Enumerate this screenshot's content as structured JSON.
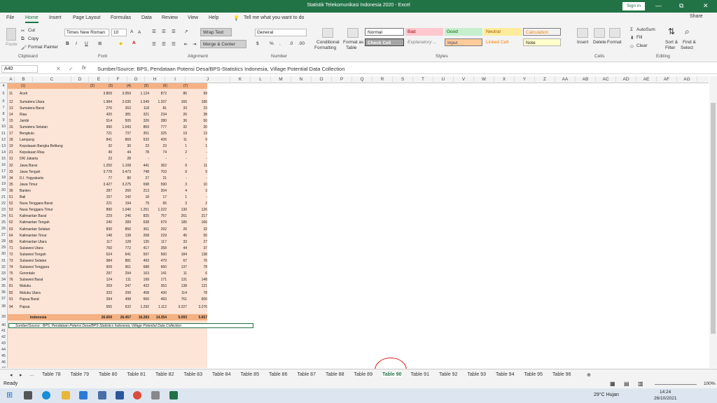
{
  "title_bar": {
    "title": "Statistik Telekomunikasi Indonesia 2020  -  Excel",
    "signin": "Sign in",
    "min": "—",
    "max": "⧉",
    "close": "✕"
  },
  "menu": {
    "tabs": [
      "File",
      "Home",
      "Insert",
      "Page Layout",
      "Formulas",
      "Data",
      "Review",
      "View",
      "Help"
    ],
    "active": "Home",
    "tell": "Tell me what you want to do",
    "share": "Share"
  },
  "ribbon": {
    "cut": "Cut",
    "copy": "Copy",
    "format_painter": "Format Painter",
    "paste": "Paste",
    "font": "Times New Roman",
    "size": "10",
    "wrap": "Wrap Text",
    "merge": "Merge & Center",
    "number_format": "General",
    "conditional": "Conditional",
    "formatting": "Formatting",
    "format_as": "Format as",
    "table": "Table",
    "styles": [
      "Normal",
      "Bad",
      "Good",
      "Neutral",
      "Calculation",
      "Check Cell",
      "Explanatory ...",
      "Input",
      "Linked Cell",
      "Note"
    ],
    "insert": "Insert",
    "delete": "Delete",
    "format": "Format",
    "autosum": "AutoSum",
    "fill": "Fill",
    "clear": "Clear",
    "sort": "Sort &",
    "filter": "Filter",
    "find": "Find &",
    "select": "Select",
    "groups": [
      "Clipboard",
      "Font",
      "Alignment",
      "Number",
      "Styles",
      "Cells",
      "Editing"
    ]
  },
  "formula_bar": {
    "name_box": "A40",
    "fx": "fx",
    "content": "Sumber/Source: BPS, Pendataan Potensi Desa/BPS-Statistics Indonesia, Village Potential Data Collection"
  },
  "columns": [
    "A",
    "B",
    "C",
    "D",
    "E",
    "F",
    "G",
    "H",
    "I",
    "J",
    "K",
    "L",
    "M",
    "N",
    "O",
    "P",
    "Q",
    "R",
    "S",
    "T",
    "U",
    "V",
    "W",
    "X",
    "Y",
    "Z",
    "AA",
    "AB",
    "AC",
    "AD",
    "AE",
    "AF",
    "AG"
  ],
  "header_row": {
    "row": "4",
    "c1": "(1)",
    "c2": "(2)",
    "c3": "(3)",
    "c4": "(4)",
    "c5": "(5)",
    "c6": "(6)",
    "c7": "(7)"
  },
  "rows": [
    {
      "r": "5",
      "code": "11",
      "prov": "Aceh",
      "v": [
        "3.809",
        "3.959",
        "1.124",
        "872",
        "86",
        "99"
      ]
    },
    {
      "r": "6",
      "code": "12",
      "prov": "Sumatera Utara",
      "v": [
        "1.984",
        "2.035",
        "1.549",
        "1.337",
        "166",
        "180"
      ]
    },
    {
      "r": "7",
      "code": "13",
      "prov": "Sumatera Barat",
      "v": [
        "276",
        "263",
        "118",
        "81",
        "33",
        "23"
      ]
    },
    {
      "r": "8",
      "code": "14",
      "prov": "Riau",
      "v": [
        "420",
        "381",
        "321",
        "234",
        "26",
        "38"
      ]
    },
    {
      "r": "9",
      "code": "15",
      "prov": "Jambi",
      "v": [
        "514",
        "505",
        "326",
        "280",
        "36",
        "50"
      ]
    },
    {
      "r": "10",
      "code": "16",
      "prov": "Sumatera Selatan",
      "v": [
        "990",
        "1.043",
        "869",
        "777",
        "32",
        "20"
      ]
    },
    {
      "r": "11",
      "code": "17",
      "prov": "Bengkulu",
      "v": [
        "721",
        "737",
        "351",
        "325",
        "19",
        "13"
      ]
    },
    {
      "r": "12",
      "code": "18",
      "prov": "Lampung",
      "v": [
        "841",
        "869",
        "532",
        "426",
        "11",
        "9"
      ]
    },
    {
      "r": "13",
      "code": "19",
      "prov": "Kepulauan Bangka Belitung",
      "v": [
        "32",
        "30",
        "23",
        "23",
        "1",
        "1"
      ]
    },
    {
      "r": "14",
      "code": "21",
      "prov": "Kepulauan Riau",
      "v": [
        "49",
        "44",
        "78",
        "74",
        "2",
        "-"
      ]
    },
    {
      "r": "15",
      "code": "31",
      "prov": "DKI Jakarta",
      "v": [
        "23",
        "28",
        "-",
        "-",
        "-",
        "-"
      ]
    },
    {
      "r": "16",
      "code": "32",
      "prov": "Jawa Barat",
      "v": [
        "1.250",
        "1.108",
        "441",
        "362",
        "9",
        "11"
      ]
    },
    {
      "r": "17",
      "code": "33",
      "prov": "Jawa Tengah",
      "v": [
        "3.778",
        "3.473",
        "748",
        "703",
        "9",
        "9"
      ]
    },
    {
      "r": "18",
      "code": "34",
      "prov": "D.I. Yogyakarta",
      "v": [
        "77",
        "80",
        "27",
        "21",
        "-",
        "-"
      ]
    },
    {
      "r": "19",
      "code": "35",
      "prov": "Jawa Timur",
      "v": [
        "3.427",
        "3.275",
        "698",
        "590",
        "3",
        "10"
      ]
    },
    {
      "r": "20",
      "code": "36",
      "prov": "Banten",
      "v": [
        "287",
        "260",
        "213",
        "204",
        "4",
        "3"
      ]
    },
    {
      "r": "21",
      "code": "51",
      "prov": "Bali",
      "v": [
        "157",
        "142",
        "18",
        "17",
        "1",
        "-"
      ]
    },
    {
      "r": "22",
      "code": "52",
      "prov": "Nusa Tenggara Barat",
      "v": [
        "221",
        "194",
        "79",
        "65",
        "3",
        "2"
      ]
    },
    {
      "r": "23",
      "code": "53",
      "prov": "Nusa Tenggara Timur",
      "v": [
        "890",
        "1.040",
        "1.251",
        "1.222",
        "130",
        "126"
      ]
    },
    {
      "r": "24",
      "code": "61",
      "prov": "Kalimantan Barat",
      "v": [
        "229",
        "246",
        "825",
        "757",
        "261",
        "217"
      ]
    },
    {
      "r": "25",
      "code": "62",
      "prov": "Kalimantan Tengah",
      "v": [
        "240",
        "289",
        "638",
        "579",
        "185",
        "166"
      ]
    },
    {
      "r": "26",
      "code": "63",
      "prov": "Kalimantan Selatan",
      "v": [
        "830",
        "856",
        "361",
        "292",
        "26",
        "32"
      ]
    },
    {
      "r": "27",
      "code": "64",
      "prov": "Kalimantan Timur",
      "v": [
        "148",
        "138",
        "268",
        "229",
        "45",
        "50"
      ]
    },
    {
      "r": "28",
      "code": "65",
      "prov": "Kalimantan Utara",
      "v": [
        "117",
        "128",
        "135",
        "117",
        "33",
        "27"
      ]
    },
    {
      "r": "29",
      "code": "71",
      "prov": "Sulawesi Utara",
      "v": [
        "760",
        "772",
        "417",
        "358",
        "44",
        "37"
      ]
    },
    {
      "r": "30",
      "code": "72",
      "prov": "Sulawesi Tengah",
      "v": [
        "624",
        "641",
        "597",
        "560",
        "184",
        "138"
      ]
    },
    {
      "r": "31",
      "code": "73",
      "prov": "Sulawesi Selatan",
      "v": [
        "984",
        "881",
        "493",
        "479",
        "67",
        "76"
      ]
    },
    {
      "r": "32",
      "code": "74",
      "prov": "Sulawesi Tenggara",
      "v": [
        "909",
        "961",
        "688",
        "660",
        "137",
        "78"
      ]
    },
    {
      "r": "33",
      "code": "75",
      "prov": "Gorontalo",
      "v": [
        "297",
        "294",
        "163",
        "141",
        "11",
        "6"
      ]
    },
    {
      "r": "34",
      "code": "76",
      "prov": "Sulawesi Barat",
      "v": [
        "124",
        "111",
        "199",
        "171",
        "131",
        "148"
      ]
    },
    {
      "r": "35",
      "code": "81",
      "prov": "Maluku",
      "v": [
        "269",
        "247",
        "422",
        "353",
        "138",
        "121"
      ]
    },
    {
      "r": "36",
      "code": "82",
      "prov": "Maluku Utara",
      "v": [
        "333",
        "299",
        "458",
        "430",
        "114",
        "78"
      ]
    },
    {
      "r": "37",
      "code": "91",
      "prov": "Papua Barat",
      "v": [
        "394",
        "498",
        "560",
        "493",
        "761",
        "600"
      ]
    },
    {
      "r": "38",
      "code": "94",
      "prov": "Papua",
      "v": [
        "555",
        "632",
        "1.292",
        "1.112",
        "3.227",
        "3.276"
      ]
    }
  ],
  "total": {
    "r": "39",
    "label": "Indonesia",
    "v": [
      "26.659",
      "26.457",
      "16.283",
      "14.354",
      "5.093",
      "5.657"
    ]
  },
  "source_row": {
    "r": "40",
    "text": "Sumber/Source : BPS, Pendataan Potensi Desa/BPS-Statistics Indonesia, Village Potential Data Collection"
  },
  "empty_rows": [
    "41",
    "42",
    "43",
    "44",
    "45",
    "46",
    "47"
  ],
  "sheet_tabs": [
    "Table 78",
    "Table 79",
    "Table 80",
    "Table 81",
    "Table 82",
    "Table 83",
    "Table 84",
    "Table 85",
    "Table 86",
    "Table 87",
    "Table 88",
    "Table 89",
    "Table 90",
    "Table 91",
    "Table 92",
    "Table 93",
    "Table 94",
    "Table 95",
    "Table 96"
  ],
  "active_sheet": "Table 90",
  "status": {
    "ready": "Ready",
    "zoom": "100%"
  },
  "taskbar": {
    "weather": "29°C  Hujan",
    "time": "14:24",
    "date": "26/10/2021"
  }
}
